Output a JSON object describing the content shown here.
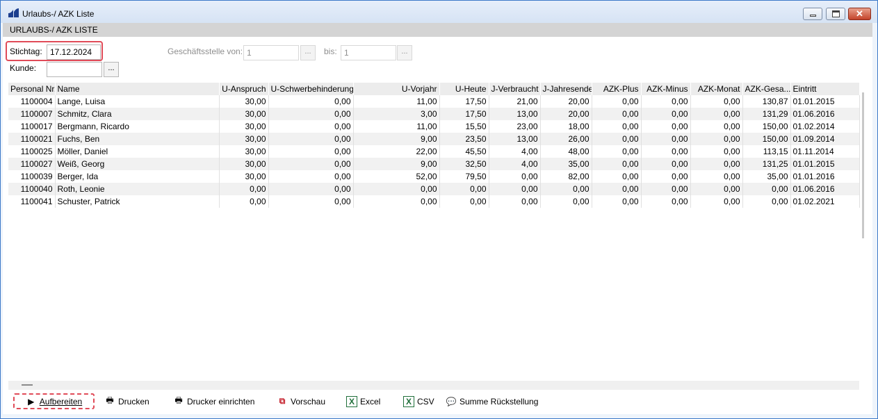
{
  "window": {
    "title": "Urlaubs-/ AZK Liste"
  },
  "subheader": {
    "title": "URLAUBS-/ AZK LISTE"
  },
  "filters": {
    "stichtag_label": "Stichtag:",
    "stichtag_value": "17.12.2024",
    "kunde_label": "Kunde:",
    "kunde_value": "",
    "geschaeftsstelle_label": "Geschäftsstelle von:",
    "geschaeftsstelle_von_value": "1",
    "bis_label": "bis:",
    "bis_value": "1",
    "ellipsis": "..."
  },
  "table": {
    "columns": [
      "Personal Nr.",
      "Name",
      "U-Anspruch",
      "U-Schwerbehinderung",
      "U-Vorjahr",
      "U-Heute",
      "J-Verbraucht",
      "J-Jahresende",
      "AZK-Plus",
      "AZK-Minus",
      "AZK-Monat",
      "AZK-Gesa...",
      "Eintritt"
    ],
    "rows": [
      [
        "1100004",
        "Lange, Luisa",
        "30,00",
        "0,00",
        "11,00",
        "17,50",
        "21,00",
        "20,00",
        "0,00",
        "0,00",
        "0,00",
        "130,87",
        "01.01.2015"
      ],
      [
        "1100007",
        "Schmitz, Clara",
        "30,00",
        "0,00",
        "3,00",
        "17,50",
        "13,00",
        "20,00",
        "0,00",
        "0,00",
        "0,00",
        "131,29",
        "01.06.2016"
      ],
      [
        "1100017",
        "Bergmann, Ricardo",
        "30,00",
        "0,00",
        "11,00",
        "15,50",
        "23,00",
        "18,00",
        "0,00",
        "0,00",
        "0,00",
        "150,00",
        "01.02.2014"
      ],
      [
        "1100021",
        "Fuchs, Ben",
        "30,00",
        "0,00",
        "9,00",
        "23,50",
        "13,00",
        "26,00",
        "0,00",
        "0,00",
        "0,00",
        "150,00",
        "01.09.2014"
      ],
      [
        "1100025",
        "Möller, Daniel",
        "30,00",
        "0,00",
        "22,00",
        "45,50",
        "4,00",
        "48,00",
        "0,00",
        "0,00",
        "0,00",
        "113,15",
        "01.11.2014"
      ],
      [
        "1100027",
        "Weiß, Georg",
        "30,00",
        "0,00",
        "9,00",
        "32,50",
        "4,00",
        "35,00",
        "0,00",
        "0,00",
        "0,00",
        "131,25",
        "01.01.2015"
      ],
      [
        "1100039",
        "Berger, Ida",
        "30,00",
        "0,00",
        "52,00",
        "79,50",
        "0,00",
        "82,00",
        "0,00",
        "0,00",
        "0,00",
        "35,00",
        "01.01.2016"
      ],
      [
        "1100040",
        "Roth, Leonie",
        "0,00",
        "0,00",
        "0,00",
        "0,00",
        "0,00",
        "0,00",
        "0,00",
        "0,00",
        "0,00",
        "0,00",
        "01.06.2016"
      ],
      [
        "1100041",
        "Schuster, Patrick",
        "0,00",
        "0,00",
        "0,00",
        "0,00",
        "0,00",
        "0,00",
        "0,00",
        "0,00",
        "0,00",
        "0,00",
        "01.02.2021"
      ]
    ]
  },
  "toolbar": {
    "aufbereiten": "Aufbereiten",
    "drucken": "Drucken",
    "drucker_einrichten": "Drucker einrichten",
    "vorschau": "Vorschau",
    "excel": "Excel",
    "csv": "CSV",
    "summe_rueckstellung": "Summe Rückstellung"
  },
  "colors": {
    "accent": "#e04b58",
    "title_bar": "#d6e3f4",
    "border": "#3b78c8"
  }
}
